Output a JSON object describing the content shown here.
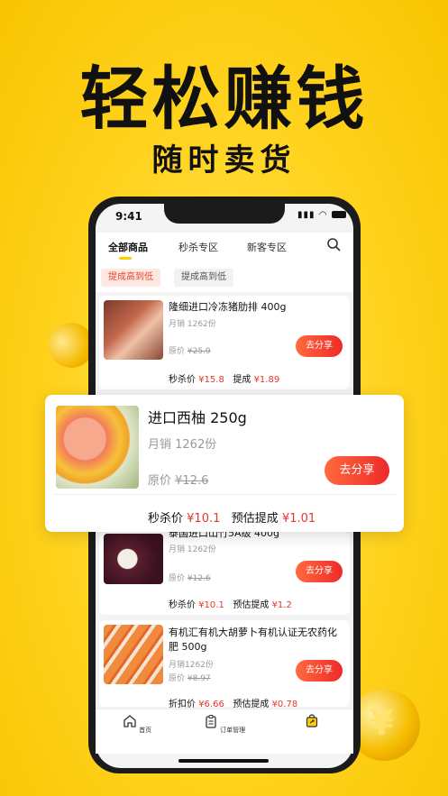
{
  "promo": {
    "headline": "轻松赚钱",
    "subline": "随时卖货"
  },
  "status_bar": {
    "time": "9:41"
  },
  "tabs": [
    {
      "label": "全部商品",
      "active": true
    },
    {
      "label": "秒杀专区",
      "active": false
    },
    {
      "label": "新客专区",
      "active": false
    }
  ],
  "filters": [
    {
      "label": "提成高到低",
      "active": true
    },
    {
      "label": "提成高到低",
      "active": false
    }
  ],
  "products": [
    {
      "title": "隆细进口冷冻猪肋排 400g",
      "sales": "月销 1262份",
      "orig_label": "原价",
      "orig_price": "¥25.9",
      "share": "去分享",
      "price_label": "秒杀价",
      "price": "¥15.8",
      "comm_label": "提成",
      "comm": "¥1.89"
    },
    {
      "title": "泰国进口山竹5A级 400g",
      "sales": "月销 1262份",
      "orig_label": "原价",
      "orig_price": "¥12.6",
      "share": "去分享",
      "price_label": "秒杀价",
      "price": "¥10.1",
      "comm_label": "预估提成",
      "comm": "¥1.2"
    },
    {
      "title": "有机汇有机大胡萝卜有机认证无农药化肥 500g",
      "sales": "月销1262份",
      "orig_label": "原价",
      "orig_price": "¥8.97",
      "share": "去分享",
      "price_label": "折扣价",
      "price": "¥6.66",
      "comm_label": "预估提成",
      "comm": "¥0.78"
    }
  ],
  "featured": {
    "title": "进口西柚 250g",
    "sales": "月销 1262份",
    "orig_label": "原价",
    "orig_price": "¥12.6",
    "share": "去分享",
    "price_label": "秒杀价",
    "price": "¥10.1",
    "comm_label": "预估提成",
    "comm": "¥1.01"
  },
  "nav": [
    {
      "label": "首页",
      "icon": "home-icon"
    },
    {
      "label": "订单管理",
      "icon": "clipboard-icon"
    },
    {
      "label": "",
      "icon": "share-bag-icon"
    }
  ],
  "colors": {
    "background": "#ffd21c",
    "accent_red": "#e8372a",
    "button_gradient_start": "#ff6a3d",
    "button_gradient_end": "#ee2a2a"
  }
}
